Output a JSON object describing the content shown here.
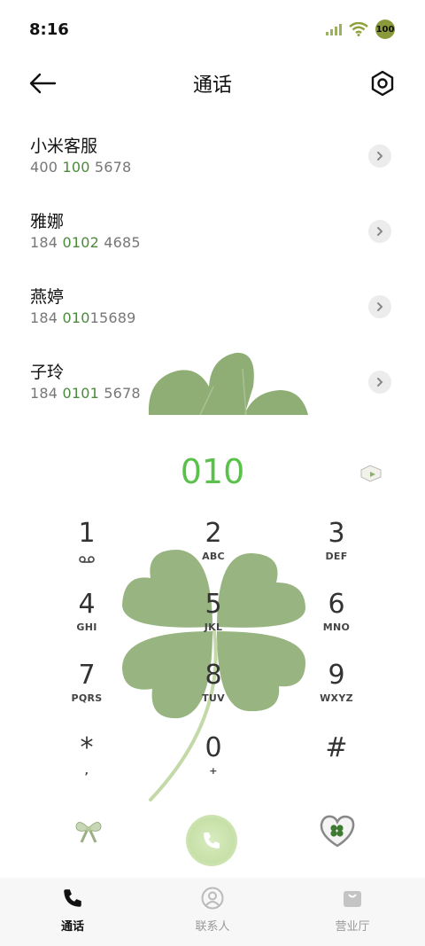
{
  "status": {
    "time": "8:16",
    "battery": "100"
  },
  "header": {
    "title": "通话"
  },
  "contacts": [
    {
      "name": "小米客服",
      "number_pre": "400 ",
      "number_hl": "100",
      "number_post": " 5678"
    },
    {
      "name": "雅娜",
      "number_pre": "184 ",
      "number_hl": "0102",
      "number_post": " 4685"
    },
    {
      "name": "燕婷",
      "number_pre": "184 ",
      "number_hl": "010",
      "number_post": "15689"
    },
    {
      "name": "子玲",
      "number_pre": "184 ",
      "number_hl": "0101",
      "number_post": " 5678"
    }
  ],
  "dial": {
    "input": "010"
  },
  "keypad": [
    {
      "digit": "1",
      "sub": ""
    },
    {
      "digit": "2",
      "sub": "ABC"
    },
    {
      "digit": "3",
      "sub": "DEF"
    },
    {
      "digit": "4",
      "sub": "GHI"
    },
    {
      "digit": "5",
      "sub": "JKL"
    },
    {
      "digit": "6",
      "sub": "MNO"
    },
    {
      "digit": "7",
      "sub": "PQRS"
    },
    {
      "digit": "8",
      "sub": "TUV"
    },
    {
      "digit": "9",
      "sub": "WXYZ"
    },
    {
      "digit": "*",
      "sub": ","
    },
    {
      "digit": "0",
      "sub": "+"
    },
    {
      "digit": "#",
      "sub": ""
    }
  ],
  "tabs": [
    {
      "label": "通话",
      "icon": "phone-icon",
      "active": true
    },
    {
      "label": "联系人",
      "icon": "contacts-icon",
      "active": false
    },
    {
      "label": "营业厅",
      "icon": "store-icon",
      "active": false
    }
  ],
  "colors": {
    "accent": "#5ac24a",
    "highlight": "#4a8a3a",
    "leaf": "#8fae76"
  }
}
